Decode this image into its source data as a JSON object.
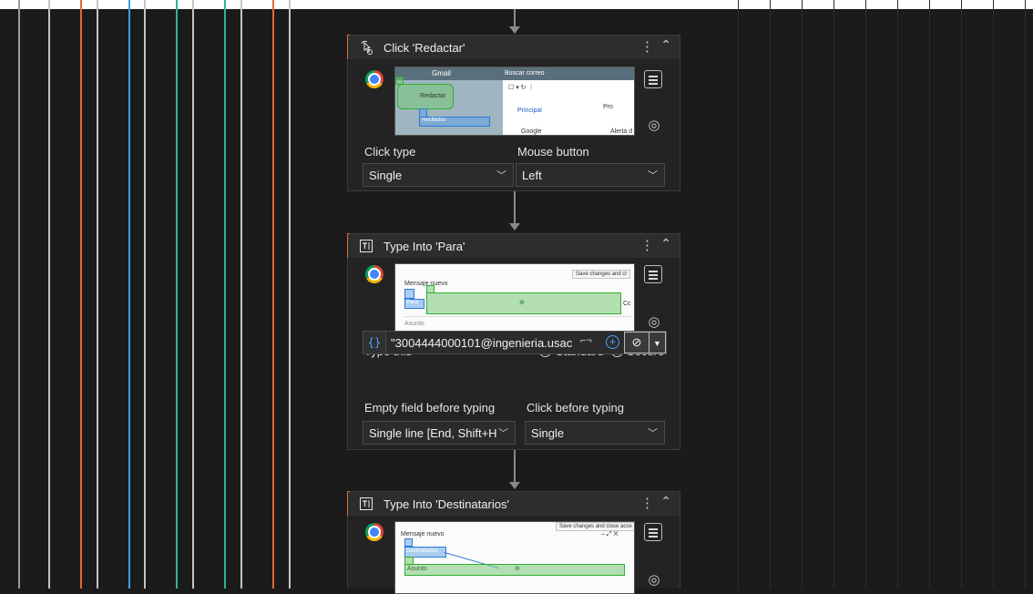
{
  "canvas": {
    "vertical_line_colors": [
      "#9b9b9b",
      "#c5c5c5",
      "#e06a34",
      "#c5c5c5",
      "#3aa0e8",
      "#c5c5c5",
      "#2fb39a",
      "#c5c5c5",
      "#2fb39a",
      "#c5c5c5",
      "#e06a34",
      "#c5c5c5"
    ]
  },
  "activities": [
    {
      "title": "Click 'Redactar'",
      "icon": "click-icon",
      "browser_icon": "chrome-icon",
      "thumbnail": {
        "app": "Gmail",
        "search": "Buscar correo",
        "compose": "Redactar",
        "inbox_label": "Recibidos",
        "tab": "Principal",
        "row": "Google",
        "row_right": "Alerta d",
        "top_right": "Pro"
      },
      "fields": {
        "click_type_label": "Click type",
        "click_type_value": "Single",
        "mouse_button_label": "Mouse button",
        "mouse_button_value": "Left"
      }
    },
    {
      "title": "Type Into 'Para'",
      "icon": "type-into-icon",
      "browser_icon": "chrome-icon",
      "thumbnail": {
        "header": "Mensaje nuevo",
        "anchor_label": "Para",
        "subject": "Asunto",
        "right_label": "Cc",
        "tooltip": "Save changes and cl"
      },
      "fields": {
        "type_this_label": "Type this",
        "mode_standard": "Standard",
        "mode_secure": "Secure",
        "selected_mode": "Standard",
        "text_value": "\"3004444000101@ingenieria.usac.ec",
        "empty_field_label": "Empty field before typing",
        "empty_field_value": "Single line [End, Shift+H",
        "click_before_label": "Click before typing",
        "click_before_value": "Single"
      }
    },
    {
      "title": "Type Into 'Destinatarios'",
      "icon": "type-into-icon",
      "browser_icon": "chrome-icon",
      "thumbnail": {
        "header": "Mensaje nuevo",
        "anchor_label": "Destinatarios",
        "subject": "Asunto",
        "tooltip": "Save changes and close acce"
      }
    }
  ]
}
